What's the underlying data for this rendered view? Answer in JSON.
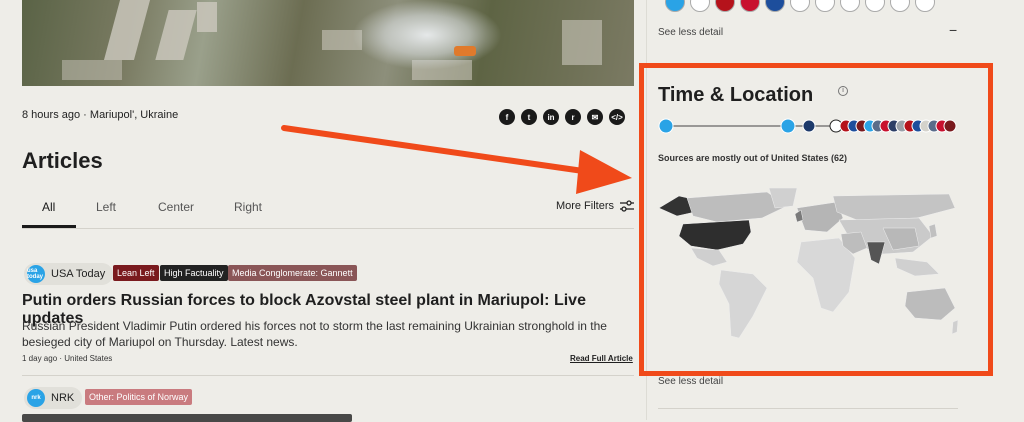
{
  "article": {
    "meta": {
      "time": "8 hours ago",
      "location": "Mariupol', Ukraine"
    },
    "share_icons": [
      "facebook-icon",
      "twitter-icon",
      "linkedin-icon",
      "reddit-icon",
      "email-icon",
      "embed-icon"
    ]
  },
  "articles": {
    "heading": "Articles",
    "tabs": [
      {
        "label": "All"
      },
      {
        "label": "Left"
      },
      {
        "label": "Center"
      },
      {
        "label": "Right"
      }
    ],
    "more_filters": "More Filters",
    "items": [
      {
        "source": "USA Today",
        "source_logo": "usa today",
        "tags": [
          {
            "label": "Lean Left",
            "color": "#7a1a1e"
          },
          {
            "label": "High Factuality",
            "color": "#222222"
          },
          {
            "label": "Media Conglomerate: Gannett",
            "color": "#8a5657"
          }
        ],
        "title": "Putin orders Russian forces to block Azovstal steel plant in Mariupol: Live updates",
        "summary": "Russian President Vladimir Putin ordered his forces not to storm the last remaining Ukrainian stronghold in the besieged city of Mariupol on Thursday. Latest news.",
        "time": "1 day ago",
        "country": "United States",
        "read_full": "Read Full Article"
      },
      {
        "source": "NRK",
        "source_logo": "nrk",
        "tags": [
          {
            "label": "Other: Politics of Norway",
            "color": "#c97b7f"
          }
        ]
      }
    ]
  },
  "sidebar": {
    "see_less_top": "See less detail",
    "time_location_title": "Time & Location",
    "info_symbol": "i",
    "sources_note": "Sources are mostly out of United States (62)",
    "see_less_bottom": "See less detail",
    "accent_color": "#f04a1a"
  }
}
